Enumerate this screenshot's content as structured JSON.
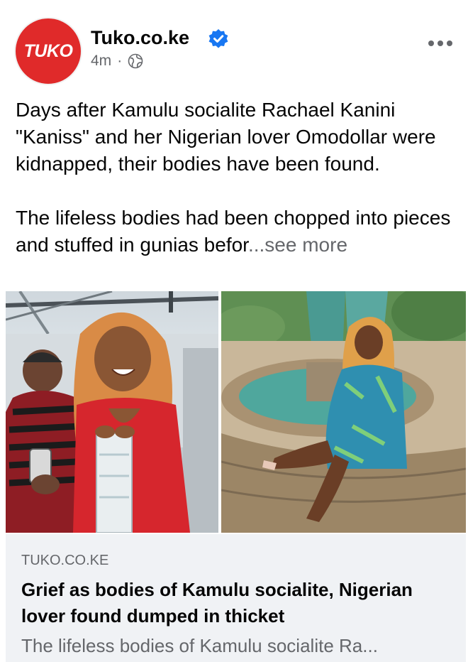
{
  "post": {
    "avatar_text": "TUKO",
    "page_name": "Tuko.co.ke",
    "time": "4m",
    "separator": "·",
    "paragraph_1": "Days after Kamulu socialite Rachael Kanini \"Kaniss\" and her Nigerian lover Omodollar were kidnapped, their bodies have been found.",
    "paragraph_2": "The lifeless bodies had been chopped into pieces and stuffed in gunias befor",
    "see_more": "...see more"
  },
  "link_preview": {
    "domain": "TUKO.CO.KE",
    "title": "Grief as bodies of Kamulu socialite, Nigerian lover found dumped in thicket",
    "description": "The lifeless bodies of Kamulu socialite Ra..."
  },
  "colors": {
    "brand_red": "#e02a2a",
    "verified_blue": "#1877f2",
    "secondary_text": "#65676b",
    "card_bg": "#f0f2f5"
  },
  "icons": [
    "verified-badge-icon",
    "globe-icon",
    "more-options-icon"
  ]
}
